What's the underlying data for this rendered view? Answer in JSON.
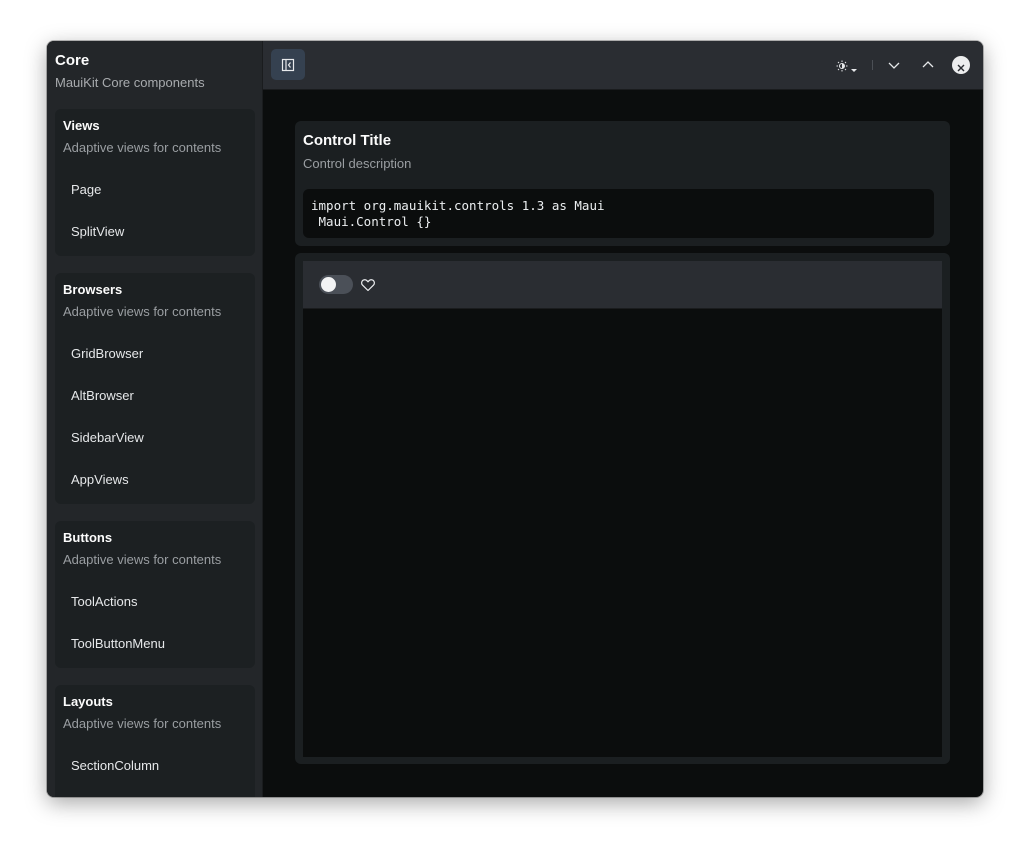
{
  "sidebar": {
    "title": "Core",
    "subtitle": "MauiKit Core components",
    "sections": [
      {
        "title": "Views",
        "subtitle": "Adaptive views for contents",
        "items": [
          "Page",
          "SplitView"
        ]
      },
      {
        "title": "Browsers",
        "subtitle": "Adaptive views for contents",
        "items": [
          "GridBrowser",
          "AltBrowser",
          "SidebarView",
          "AppViews"
        ]
      },
      {
        "title": "Buttons",
        "subtitle": "Adaptive views for contents",
        "items": [
          "ToolActions",
          "ToolButtonMenu"
        ]
      },
      {
        "title": "Layouts",
        "subtitle": "Adaptive views for contents",
        "items": [
          "SectionColumn"
        ]
      }
    ]
  },
  "headerbar": {
    "sidebar_toggle_icon": "sidebar-collapse-icon",
    "style_icon": "brightness-icon",
    "style_dropdown_icon": "caret-down-icon",
    "window_buttons": [
      "minimize-icon",
      "maximize-icon",
      "close-icon"
    ]
  },
  "control": {
    "title": "Control Title",
    "description": "Control description",
    "code": "import org.mauikit.controls 1.3 as Maui\n Maui.Control {}"
  },
  "demo": {
    "toolbar": {
      "switch_checked": false,
      "heart_icon": "heart-icon"
    }
  },
  "colors": {
    "window_bg": "#0b0d0d",
    "sidebar_bg": "#232629",
    "card_bg": "#1b1f21",
    "headerbar_bg": "#2a2d32",
    "accent_button": "#354150"
  }
}
